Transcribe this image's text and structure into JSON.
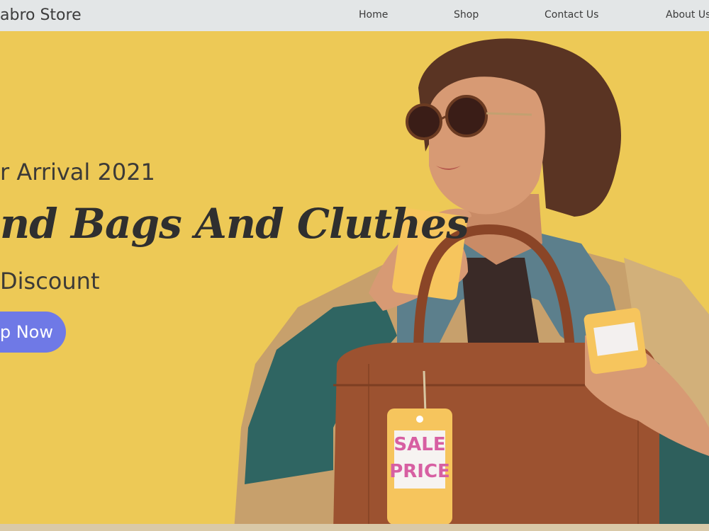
{
  "nav": {
    "brand": "abro Store",
    "links": [
      "Home",
      "Shop",
      "Contact Us",
      "About Us"
    ]
  },
  "hero": {
    "subtitle": "r Arrival 2021",
    "headline": "nd Bags And Cluthes",
    "discount": "Discount",
    "cta_label": "p Now",
    "tag_line1": "SALE",
    "tag_line2": "PRICE"
  },
  "colors": {
    "nav_bg": "#e3e6e7",
    "hero_bg": "#edc956",
    "cta_bg": "#6f79e6",
    "bag": "#9c5230",
    "tag": "#f6c55d",
    "tag_text": "#d75fa2"
  }
}
